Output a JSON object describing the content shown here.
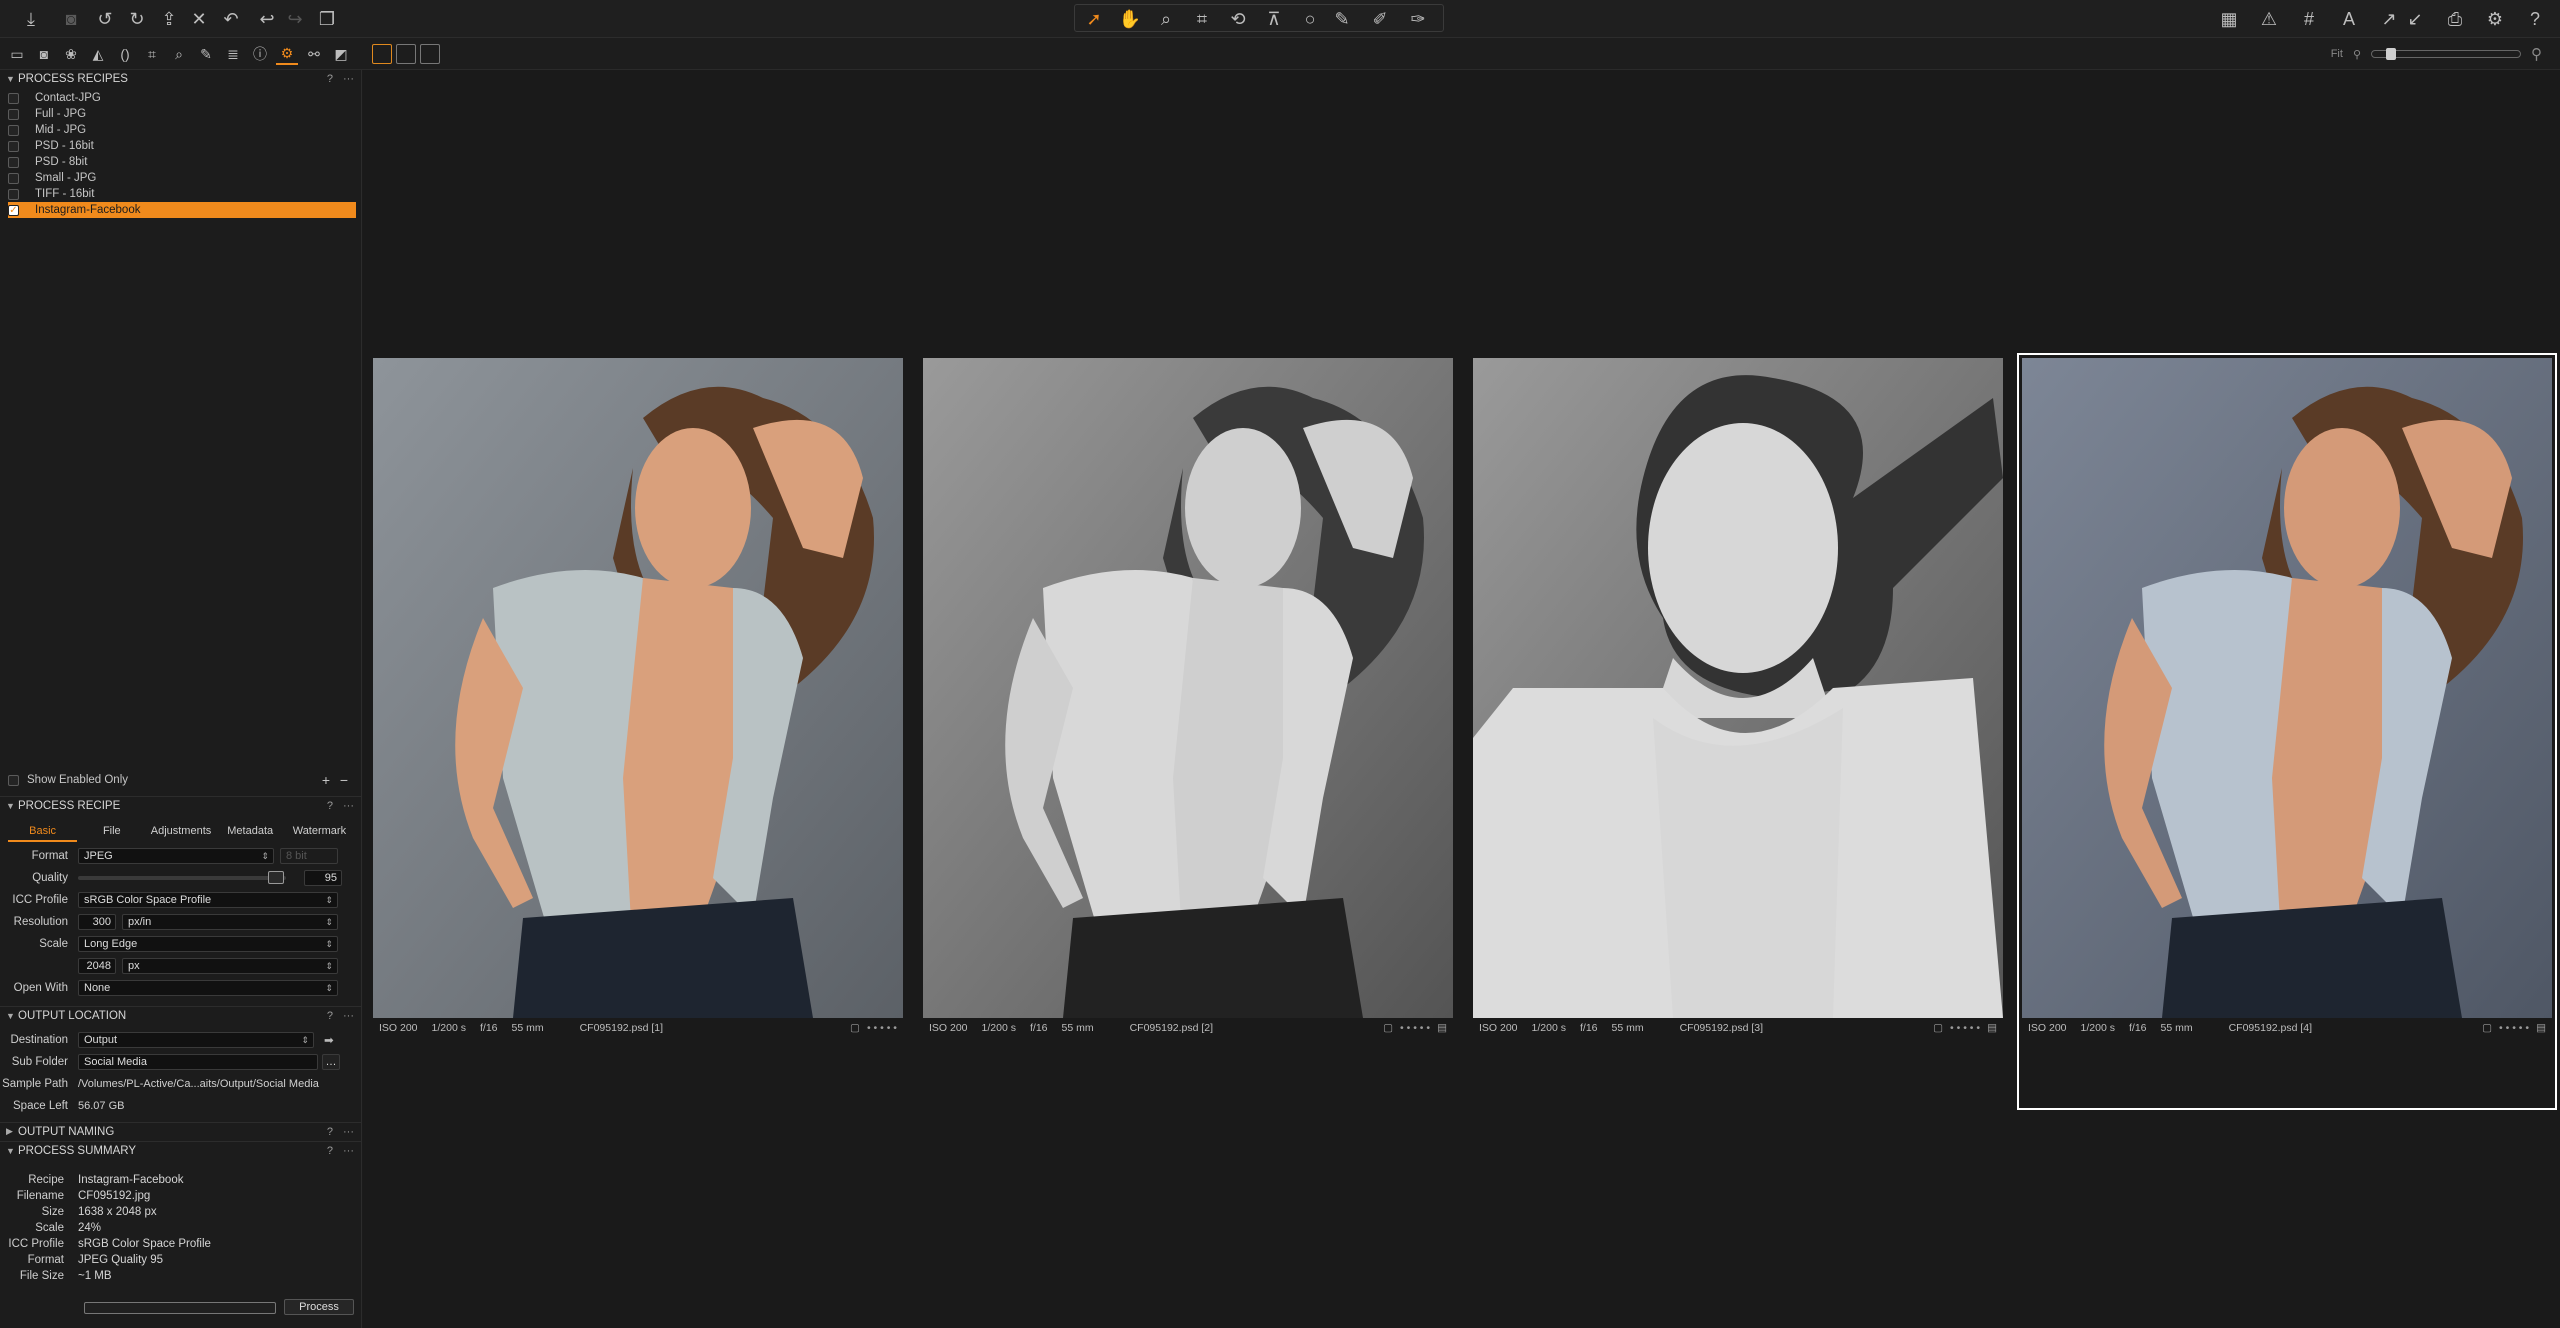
{
  "toolbar": {
    "left_icons": [
      "import-icon",
      "camera-icon",
      "rotate-left-icon",
      "rotate-right-icon",
      "move-icon",
      "delete-icon",
      "undo-history-icon",
      "undo-icon",
      "redo-icon",
      "copy-icon"
    ],
    "cursor_icons": [
      "select-pointer-icon",
      "pan-hand-icon",
      "loupe-icon",
      "crop-icon",
      "rotate-straighten-icon",
      "keystone-icon",
      "spot-removal-icon",
      "picker-icon",
      "brush-icon",
      "eraser-icon"
    ],
    "right_icons": [
      "grid-layout-icon",
      "exposure-warning-icon",
      "grid-icon",
      "text-annotation-icon",
      "copy-adjustments-icon",
      "apply-adjustments-icon",
      "print-icon",
      "settings-gear-icon",
      "help-icon"
    ]
  },
  "tool_tabs": [
    "folder-icon",
    "capture-icon",
    "color-icon",
    "exposure-icon",
    "lens-icon",
    "crop-tab-icon",
    "focus-icon",
    "retouch-icon",
    "metadata-icon",
    "info-icon",
    "output-gear-icon",
    "batch-icon",
    "adjustments-tab-icon"
  ],
  "zoom": {
    "label": "Fit"
  },
  "process_recipes": {
    "title": "PROCESS RECIPES",
    "items": [
      {
        "label": "Contact-JPG",
        "checked": false
      },
      {
        "label": "Full - JPG",
        "checked": false
      },
      {
        "label": "Mid - JPG",
        "checked": false
      },
      {
        "label": "PSD - 16bit",
        "checked": false
      },
      {
        "label": "PSD - 8bit",
        "checked": false
      },
      {
        "label": "Small - JPG",
        "checked": false
      },
      {
        "label": "TIFF - 16bit",
        "checked": false
      },
      {
        "label": "Instagram-Facebook",
        "checked": true
      }
    ],
    "show_enabled_only": "Show Enabled Only"
  },
  "process_recipe": {
    "title": "PROCESS RECIPE",
    "tabs": [
      "Basic",
      "File",
      "Adjustments",
      "Metadata",
      "Watermark"
    ],
    "format_label": "Format",
    "format_value": "JPEG",
    "bit_depth": "8 bit",
    "quality_label": "Quality",
    "quality_value": "95",
    "icc_label": "ICC Profile",
    "icc_value": "sRGB Color Space Profile",
    "resolution_label": "Resolution",
    "resolution_value": "300",
    "resolution_unit": "px/in",
    "scale_label": "Scale",
    "scale_value": "Long Edge",
    "scale_size": "2048",
    "scale_unit": "px",
    "open_with_label": "Open With",
    "open_with_value": "None"
  },
  "output_location": {
    "title": "OUTPUT LOCATION",
    "destination_label": "Destination",
    "destination_value": "Output",
    "subfolder_label": "Sub Folder",
    "subfolder_value": "Social Media",
    "sample_path_label": "Sample Path",
    "sample_path_value": "/Volumes/PL-Active/Ca...aits/Output/Social Media",
    "space_left_label": "Space Left",
    "space_left_value": "56.07 GB"
  },
  "output_naming": {
    "title": "OUTPUT NAMING"
  },
  "process_summary": {
    "title": "PROCESS SUMMARY",
    "rows": [
      {
        "k": "Recipe",
        "v": "Instagram-Facebook"
      },
      {
        "k": "Filename",
        "v": "CF095192.jpg"
      },
      {
        "k": "Size",
        "v": "1638 x 2048 px"
      },
      {
        "k": "Scale",
        "v": "24%"
      },
      {
        "k": "ICC Profile",
        "v": "sRGB Color Space Profile"
      },
      {
        "k": "Format",
        "v": "JPEG Quality 95"
      },
      {
        "k": "File Size",
        "v": "~1 MB"
      }
    ],
    "process_button": "Process"
  },
  "thumbnails": [
    {
      "iso": "ISO 200",
      "shutter": "1/200 s",
      "aperture": "f/16",
      "focal": "55 mm",
      "filename": "CF095192.psd [1]",
      "style": "color",
      "selected": false
    },
    {
      "iso": "ISO 200",
      "shutter": "1/200 s",
      "aperture": "f/16",
      "focal": "55 mm",
      "filename": "CF095192.psd [2]",
      "style": "bw",
      "selected": false
    },
    {
      "iso": "ISO 200",
      "shutter": "1/200 s",
      "aperture": "f/16",
      "focal": "55 mm",
      "filename": "CF095192.psd [3]",
      "style": "bw-close",
      "selected": false
    },
    {
      "iso": "ISO 200",
      "shutter": "1/200 s",
      "aperture": "f/16",
      "focal": "55 mm",
      "filename": "CF095192.psd [4]",
      "style": "color-blue",
      "selected": true
    }
  ],
  "colors": {
    "accent": "#f08a1c",
    "bg": "#1b1b1b"
  }
}
